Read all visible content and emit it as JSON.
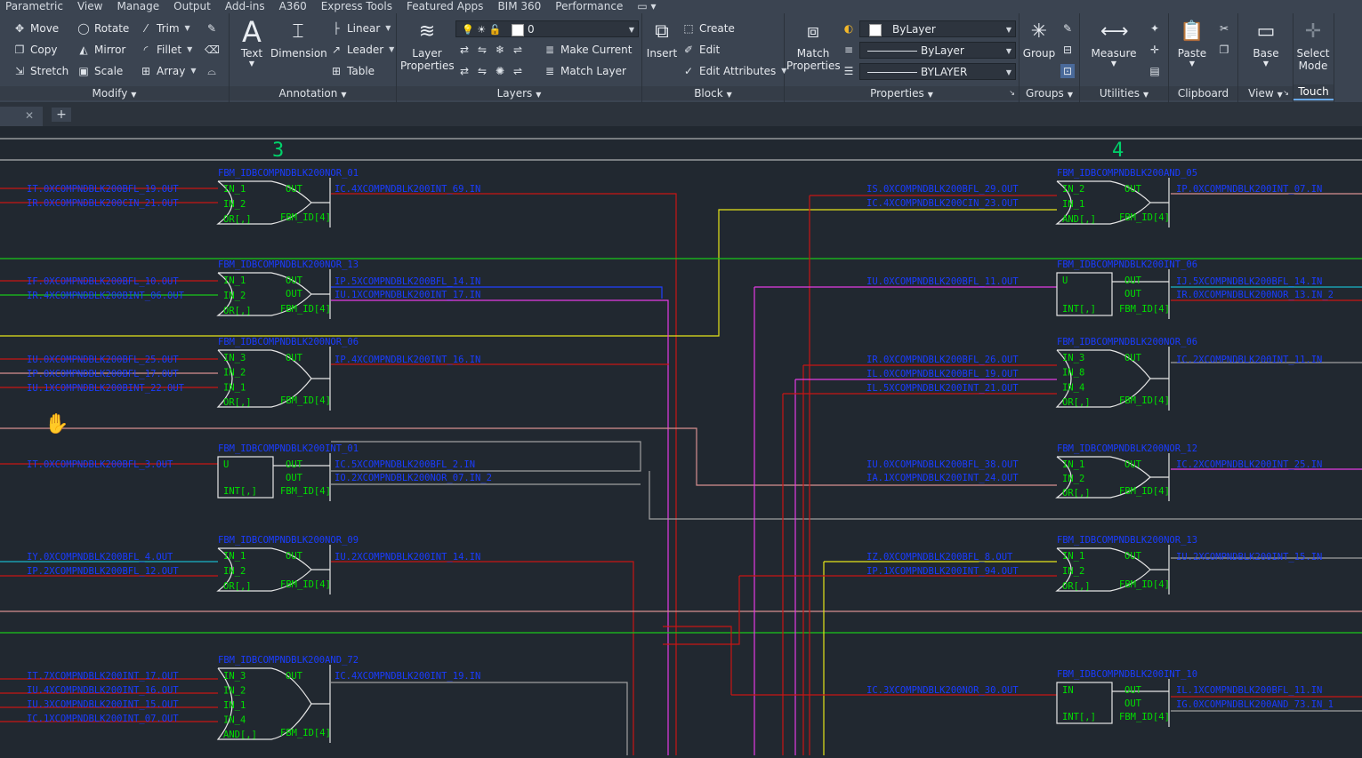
{
  "menu": {
    "tabs": [
      "Parametric",
      "View",
      "Manage",
      "Output",
      "Add-ins",
      "A360",
      "Express Tools",
      "Featured Apps",
      "BIM 360",
      "Performance"
    ]
  },
  "ribbon": {
    "modify": {
      "title": "Modify",
      "move": "Move",
      "rotate": "Rotate",
      "trim": "Trim",
      "copy": "Copy",
      "mirror": "Mirror",
      "fillet": "Fillet",
      "stretch": "Stretch",
      "scale": "Scale",
      "array": "Array"
    },
    "annotation": {
      "title": "Annotation",
      "text": "Text",
      "dimension": "Dimension",
      "linear": "Linear",
      "leader": "Leader",
      "table": "Table"
    },
    "layers": {
      "title": "Layers",
      "layer_properties": "Layer Properties",
      "layer_combo": "0",
      "make_current": "Make Current",
      "match_layer": "Match Layer"
    },
    "block": {
      "title": "Block",
      "insert": "Insert",
      "create": "Create",
      "edit": "Edit",
      "edit_attributes": "Edit Attributes"
    },
    "properties": {
      "title": "Properties",
      "match_properties": "Match Properties",
      "color": "ByLayer",
      "linetype": "ByLayer",
      "lineweight": "BYLAYER"
    },
    "groups": {
      "title": "Groups",
      "group": "Group"
    },
    "utilities": {
      "title": "Utilities",
      "measure": "Measure"
    },
    "clipboard": {
      "title": "Clipboard",
      "paste": "Paste"
    },
    "view": {
      "title": "View",
      "base": "Base"
    },
    "touch": {
      "title": "Touch",
      "select_mode": "Select Mode"
    }
  },
  "drawing": {
    "column_labels": [
      "3",
      "4"
    ],
    "blocks": [
      {
        "title": "FBM_IDBCOMPNDBLK200NOR_01",
        "inputs": [
          "IN_1",
          "IN_2",
          "OR[,]"
        ],
        "outs": [
          "OUT"
        ],
        "fbm": "FBM_ID[4]"
      },
      {
        "title": "FBM_IDBCOMPNDBLK200NOR_13",
        "inputs": [
          "IN_1",
          "IN_2",
          "OR[,]"
        ],
        "outs": [
          "OUT",
          "OUT"
        ],
        "fbm": "FBM_ID[4]"
      },
      {
        "title": "FBM_IDBCOMPNDBLK200NOR_06",
        "inputs": [
          "IN_3",
          "IN_2",
          "IN_1",
          "OR[,]"
        ],
        "outs": [
          "OUT"
        ],
        "fbm": "FBM_ID[4]"
      },
      {
        "title": "FBM_IDBCOMPNDBLK200INT_01",
        "inputs": [
          "U",
          "INT[,]"
        ],
        "outs": [
          "OUT",
          "OUT"
        ],
        "fbm": "FBM_ID[4]"
      },
      {
        "title": "FBM_IDBCOMPNDBLK200NOR_09",
        "inputs": [
          "IN_1",
          "IN_2",
          "OR[,]"
        ],
        "outs": [
          "OUT"
        ],
        "fbm": "FBM_ID[4]"
      },
      {
        "title": "FBM_IDBCOMPNDBLK200AND_72",
        "inputs": [
          "IN_3",
          "IN_2",
          "IN_1",
          "IN_4",
          "AND[,]"
        ],
        "outs": [
          "OUT"
        ],
        "fbm": "FBM_ID[4]"
      },
      {
        "title": "FBM_IDBCOMPNDBLK200AND_05",
        "inputs": [
          "IN_2",
          "IN_1",
          "AND[,]"
        ],
        "outs": [
          "OUT"
        ],
        "fbm": "FBM_ID[4]"
      },
      {
        "title": "FBM_IDBCOMPNDBLK200INT_06",
        "inputs": [
          "U",
          "INT[,]"
        ],
        "outs": [
          "OUT",
          "OUT"
        ],
        "fbm": "FBM_ID[4]"
      },
      {
        "title": "FBM_IDBCOMPNDBLK200NOR_06",
        "inputs": [
          "IN_3",
          "IN_8",
          "IN_4",
          "OR[,]"
        ],
        "outs": [
          "OUT"
        ],
        "fbm": "FBM_ID[4]"
      },
      {
        "title": "FBM_IDBCOMPNDBLK200NOR_12",
        "inputs": [
          "IN_1",
          "IN_2",
          "OR[,]"
        ],
        "outs": [
          "OUT"
        ],
        "fbm": "FBM_ID[4]"
      },
      {
        "title": "FBM_IDBCOMPNDBLK200NOR_13",
        "inputs": [
          "IN_1",
          "IN_2",
          "OR[,]"
        ],
        "outs": [
          "OUT"
        ],
        "fbm": "FBM_ID[4]"
      },
      {
        "title": "FBM_IDBCOMPNDBLK200INT_10",
        "inputs": [
          "IN",
          "INT[,]"
        ],
        "outs": [
          "OUT",
          "OUT"
        ],
        "fbm": "FBM_ID[4]"
      }
    ],
    "net_labels": {
      "left_in": [
        "IT.0XCOMPNDBLK200BFL_19.OUT",
        "IR.0XCOMPNDBLK200CIN_21.OUT",
        "IF.0XCOMPNDBLK200BFL_10.OUT",
        "IR.4XCOMPNDBLK200BINT_06.OUT",
        "IU.0XCOMPNDBLK200BFL_25.OUT",
        "IP.0XCOMPNDBLK200BFL_17.OUT",
        "IU.1XCOMPNDBLK200BINT_22.OUT",
        "IT.0XCOMPNDBLK200BFL_3.OUT",
        "IY.0XCOMPNDBLK200BFL_4.OUT",
        "IP.2XCOMPNDBLK200BFL_12.OUT",
        "IT.7XCOMPNDBLK200INT_17.OUT",
        "IU.4XCOMPNDBLK200INT_16.OUT",
        "IU.3XCOMPNDBLK200INT_15.OUT",
        "IC.1XCOMPNDBLK200INT_07.OUT"
      ],
      "left_out": [
        "IC.4XCOMPNDBLK200INT_69.IN",
        "IP.5XCOMPNDBLK200BFL_14.IN",
        "IU.1XCOMPNDBLK200INT_17.IN",
        "IP.4XCOMPNDBLK200INT_16.IN",
        "IC.5XCOMPNDBLK200BFL_2.IN",
        "IO.2XCOMPNDBLK200NOR_07.IN_2",
        "IU.2XCOMPNDBLK200INT_14.IN",
        "IC.4XCOMPNDBLK200INT_19.IN"
      ],
      "right_in": [
        "IS.0XCOMPNDBLK200BFL_29.OUT",
        "IC.4XCOMPNDBLK200CIN_23.OUT",
        "IU.0XCOMPNDBLK200BFL_11.OUT",
        "IR.0XCOMPNDBLK200BFL_26.OUT",
        "IL.0XCOMPNDBLK200BFL_19.OUT",
        "IL.5XCOMPNDBLK200INT_21.OUT",
        "IU.0XCOMPNDBLK200BFL_38.OUT",
        "IA.1XCOMPNDBLK200INT_24.OUT",
        "IZ.0XCOMPNDBLK200BFL_8.OUT",
        "IP.1XCOMPNDBLK200INT_94.OUT",
        "IC.3XCOMPNDBLK200NOR_30.OUT"
      ],
      "right_out": [
        "IP.0XCOMPNDBLK200INT_07.IN",
        "IJ.5XCOMPNDBLK200BFL_14.IN",
        "IR.0XCOMPNDBLK200NOR_13.IN_2",
        "IC.2XCOMPNDBLK200INT_11.IN",
        "IC.2XCOMPNDBLK200INT_25.IN",
        "IU.2XCOMPNDBLK200INT_15.IN",
        "IL.1XCOMPNDBLK200BFL_11.IN",
        "IG.0XCOMPNDBLK200AND_73.IN_1"
      ]
    }
  },
  "colors": {
    "ribbon_bg": "#3b4451",
    "canvas_bg": "#212830",
    "block": "#e6e6e6",
    "pin_label": "#00e000",
    "net_label": "#1a3cff",
    "frame_text": "#00d26a",
    "wire_red": "#c81414",
    "wire_yellow": "#e5e51a",
    "wire_magenta": "#e33be3",
    "wire_green": "#19c819",
    "wire_cyan": "#19b4c8",
    "wire_salmon": "#d89090",
    "wire_grey": "#a0a0a0",
    "wire_blue": "#2040ff"
  }
}
